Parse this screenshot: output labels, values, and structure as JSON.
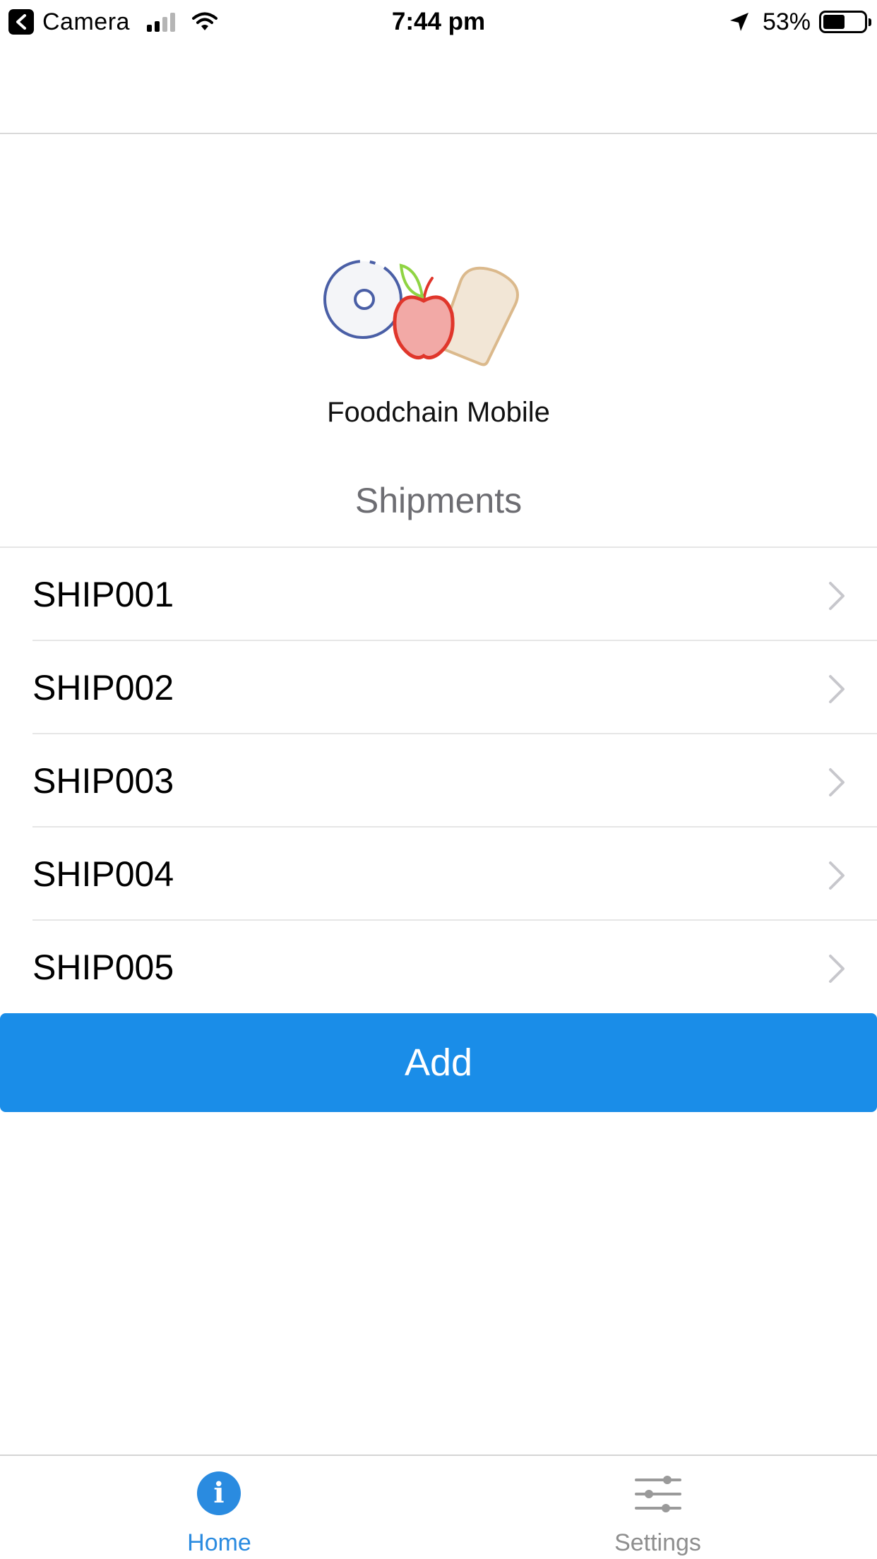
{
  "status_bar": {
    "back_app": "Camera",
    "time": "7:44 pm",
    "battery_percent": "53%",
    "battery_level": 0.53,
    "signal_bars": 2,
    "icons": [
      "back-arrow-icon",
      "signal-icon",
      "wifi-icon",
      "location-arrow-icon",
      "battery-icon"
    ]
  },
  "app": {
    "name": "Foodchain Mobile",
    "logo_icon": "foodchain-logo-icon"
  },
  "section": {
    "title": "Shipments"
  },
  "shipments": [
    {
      "label": "SHIP001"
    },
    {
      "label": "SHIP002"
    },
    {
      "label": "SHIP003"
    },
    {
      "label": "SHIP004"
    },
    {
      "label": "SHIP005"
    }
  ],
  "actions": {
    "add_label": "Add"
  },
  "tab_bar": {
    "tabs": [
      {
        "label": "Home",
        "icon": "info-icon",
        "active": true
      },
      {
        "label": "Settings",
        "icon": "sliders-icon",
        "active": false
      }
    ]
  },
  "colors": {
    "accent": "#1a8de8",
    "tab_active": "#2a8be0",
    "tab_inactive": "#8e8e8e",
    "section_title": "#6d6d72"
  }
}
